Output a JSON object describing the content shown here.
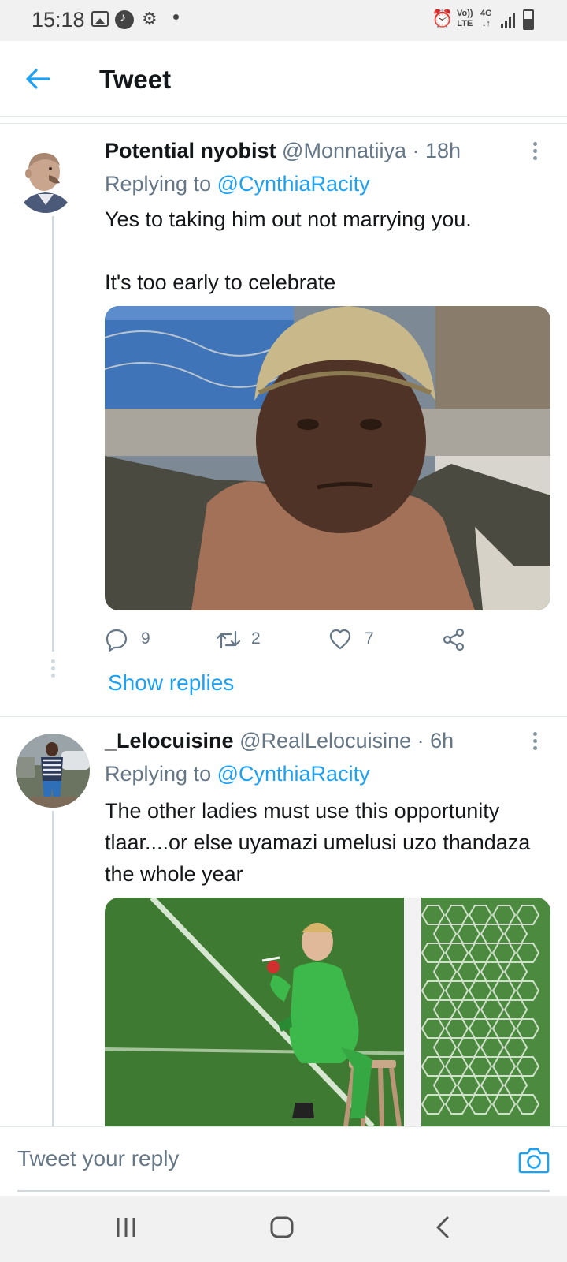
{
  "status_bar": {
    "time": "15:18",
    "volte_line1": "Vo))",
    "volte_line2": "LTE",
    "network_line1": "4G",
    "network_line2": "↓↑",
    "icons": [
      "gallery-icon",
      "music-icon",
      "gear-icon",
      "dot-icon",
      "alarm-icon",
      "volte-icon",
      "4g-icon",
      "signal-icon",
      "battery-icon"
    ]
  },
  "header": {
    "title": "Tweet",
    "back_icon": "arrow-left-icon"
  },
  "tweets": [
    {
      "name": "Potential nyobist",
      "handle": "@Monnatiiya · 18h",
      "replying_prefix": "Replying to ",
      "replying_to": "@CynthiaRacity",
      "text": "Yes to taking him out not marrying you.\n\nIt's too early to celebrate",
      "media_kind": "photo of a man wearing a knitted beanie",
      "actions": {
        "replies": "9",
        "retweets": "2",
        "likes": "7"
      },
      "show_replies": "Show replies"
    },
    {
      "name": "_Lelocuisine",
      "handle": "@RealLelocuisine · 6h",
      "replying_prefix": "Replying to ",
      "replying_to": "@CynthiaRacity",
      "text": "The other ladies must use this opportunity tlaar....or else uyamazi umelusi uzo thandaza the whole year",
      "media_kind": "photo of a goalkeeper in green sitting on a stool by the goalpost"
    }
  ],
  "reply_bar": {
    "placeholder": "Tweet your reply",
    "camera_icon": "camera-icon"
  },
  "nav_bar": {
    "icons": [
      "recent-apps-icon",
      "home-icon",
      "back-icon"
    ]
  },
  "colors": {
    "accent": "#1da1f2",
    "text": "#14171a",
    "secondary_text": "#657786",
    "status_bar_bg": "#f1f1f1",
    "divider": "#e1e8ed"
  }
}
